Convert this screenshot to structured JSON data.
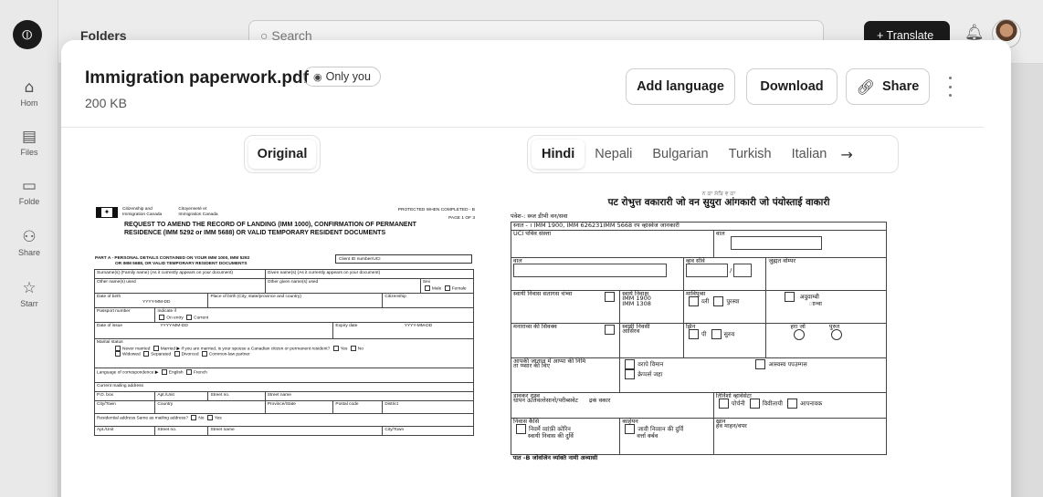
{
  "app": {
    "sidebar": {
      "items": [
        {
          "label": "Hom",
          "icon": "home-icon",
          "glyph": "⌂"
        },
        {
          "label": "Files",
          "icon": "file-icon",
          "glyph": "▤"
        },
        {
          "label": "Folde",
          "icon": "folder-icon",
          "glyph": "▭"
        },
        {
          "label": "Share",
          "icon": "users-icon",
          "glyph": "⚇"
        },
        {
          "label": "Starr",
          "icon": "star-icon",
          "glyph": "☆"
        }
      ]
    },
    "header": {
      "title": "Folders",
      "search_placeholder": "Search",
      "translate_label": "+ Translate"
    }
  },
  "modal": {
    "file_name": "Immigration paperwork.pdf",
    "visibility": "Only you",
    "file_size": "200 KB",
    "buttons": {
      "add_language": "Add language",
      "download": "Download",
      "share": "Share"
    },
    "original_tab": "Original",
    "language_tabs": [
      "Hindi",
      "Nepali",
      "Bulgarian",
      "Turkish",
      "Italian"
    ],
    "active_language": "Hindi"
  },
  "original_doc": {
    "agency_en": "Citizenship and\nImmigration Canada",
    "agency_fr": "Citoyenneté et\nImmigration Canada",
    "protected": "PROTECTED WHEN COMPLETED - B",
    "page": "PAGE 1 OF 3",
    "title_line1": "REQUEST TO AMEND THE RECORD OF LANDING (IMM 1000), CONFIRMATION OF PERMANENT",
    "title_line2": "RESIDENCE (IMM 5292 or IMM 5688) OR VALID TEMPORARY RESIDENT DOCUMENTS",
    "part_a_line1": "PART A - PERSONAL DETAILS CONTAINED ON YOUR IMM 1000, IMM 5292",
    "part_a_line2": "OR IMM 5688, OR VALID TEMPORARY RESIDENT DOCUMENTS",
    "client_id": "Client ID number/UCI",
    "fields": {
      "surname": "Surname(s) (Family name) (As it currently appears on your document)",
      "given_name": "Given name(s) (As it currently appears on your document)",
      "other_name": "Other name(s) used",
      "other_given": "Other given name(s) used",
      "sex": "Sex",
      "male": "Male",
      "female": "Female",
      "dob": "Date of birth",
      "date_format": "YYYY-MM-DD",
      "pob": "Place of birth (City, state/province and country)",
      "citizenship": "Citizenship",
      "passport": "Passport number",
      "indicate_if": "Indicate if",
      "on_entry": "On entry",
      "current": "Current",
      "date_issue": "Date of issue",
      "expiry": "Expiry date",
      "marital_status": "Marital status",
      "never_married": "Never married",
      "married": "Married",
      "widowed": "Widowed",
      "separated": "Separated",
      "divorced": "Divorced",
      "common_law": "Common-law partner",
      "spouse_q": "If you are married, is your spouse a Canadian citizen or permanent resident?",
      "yes": "Yes",
      "no": "No",
      "language_corr": "Language of correspondence",
      "english": "English",
      "french": "French",
      "mailing": "Current mailing address",
      "po_box": "P.O. box",
      "apt_unit": "Apt./Unit",
      "street_no": "Street no.",
      "street_name": "Street name",
      "city_town": "City/Town",
      "country": "Country",
      "province_state": "Province/State",
      "postal_code": "Postal code",
      "district": "District",
      "residential": "Residential address  Same as mailing address?"
    }
  },
  "translated_doc": {
    "heading_top": "ਨ ਕਾ ਸੰਬਿ ਵ ਕਾ",
    "heading": "पट रोभुत्त वकारारी जो वन सुयुरा आंगकारी जो पंयोस्ताई वाकारी",
    "sub": "पंवेश-: स्व्ज डीभी वन/सवा",
    "row_intro": "स्नात - । IMM 1900, IMM 626231IMM 5668 रप व्हास्वेज जानकारी",
    "uci": "UCI पविव संस्त्ता",
    "naam": "वाल",
    "naam2": "वाल",
    "janm_tithi": "व्हव सीवे",
    "janm_sthan": "जुह्मत वोम्पर",
    "sthayi": "स्वायी निवास सतागस चंभ्वा",
    "sthayi_niwas": "स्वाये निवाक्ष",
    "imm1900": "IMM 1900",
    "imm1308": "IMM 1308",
    "mahila": "माविपुव्स",
    "kali": "व्ली",
    "purush": "पुरस्वा",
    "avujaa": "अवुवाम्बी",
    "anya": "ाान्वा",
    "manaras": "मनाराव्स की सिवक्व",
    "sthayi_niwasi": "स्वायी निवसी",
    "asthir": "आसिरव",
    "jhin": "झिन",
    "pi": "पी",
    "suruv": "सुरुव",
    "hala": "हरा  जो",
    "purut": "पुरुत",
    "aapki": "आपकी जाताल में आप्पा की निमि",
    "ta_pasaar": "ता प्प्सार की विए",
    "vartan": "वरापे विमान",
    "aaswash": "आस्वस्व पपउम्गस",
    "sepas": "क्रेप्पर्स जहा",
    "sadhar": "डावकर रास्व",
    "dhapan": "धापन  ऊतिवल्तेसानो/परीब्सवेट",
    "drang": "द्रकं वकार",
    "tirnisho": "तिर्निशो व्हावेसेटा",
    "ponchi": "पोर्चनी",
    "vishvasi": "विवीलायी",
    "aapnavak": "आपनावक",
    "nivas_kaise": "निवास कैसि",
    "kaheyan": "काहेयन",
    "khan": "खान",
    "nikki": "निवर्मे व्वांफ़ी कोरिन",
    "sthayi_nivas2": "स्वायी निवास की दुर्वि",
    "jaavi": "जावी निव्वान की दुर्वि",
    "varg": "वर्त्ता र्क्बव",
    "hech": "हेव  माहन/वपर",
    "part_b": "पात -B  जोवजिन व्यक्ति नामी अव्यासी"
  }
}
